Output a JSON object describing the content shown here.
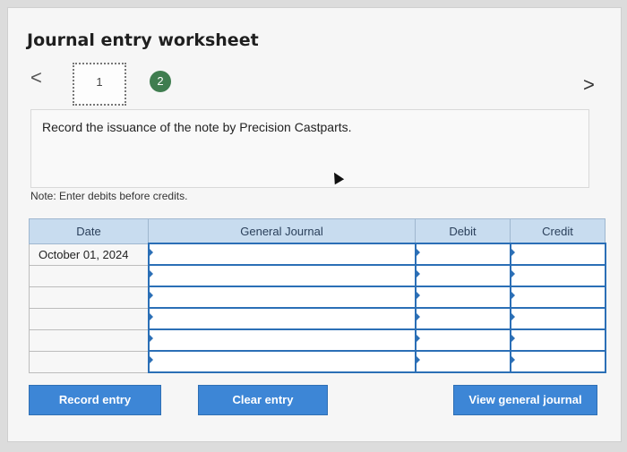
{
  "title": "Journal entry worksheet",
  "nav": {
    "prev_icon": "<",
    "next_icon": ">"
  },
  "steps": [
    {
      "label": "1",
      "state": "inactive"
    },
    {
      "label": "2",
      "state": "active",
      "color": "#3f7d4f"
    }
  ],
  "instruction": "Record the issuance of the note by Precision Castparts.",
  "note": "Note: Enter debits before credits.",
  "table": {
    "headers": {
      "date": "Date",
      "general_journal": "General Journal",
      "debit": "Debit",
      "credit": "Credit"
    },
    "rows": [
      {
        "date": "October 01, 2024",
        "account": "",
        "debit": "",
        "credit": ""
      },
      {
        "date": "",
        "account": "",
        "debit": "",
        "credit": ""
      },
      {
        "date": "",
        "account": "",
        "debit": "",
        "credit": ""
      },
      {
        "date": "",
        "account": "",
        "debit": "",
        "credit": ""
      },
      {
        "date": "",
        "account": "",
        "debit": "",
        "credit": ""
      },
      {
        "date": "",
        "account": "",
        "debit": "",
        "credit": ""
      }
    ]
  },
  "buttons": {
    "record": "Record entry",
    "clear": "Clear entry",
    "view": "View general journal"
  },
  "colors": {
    "accent": "#3d86d6",
    "header_bg": "#c8dcef",
    "input_border": "#2b6fb6"
  }
}
